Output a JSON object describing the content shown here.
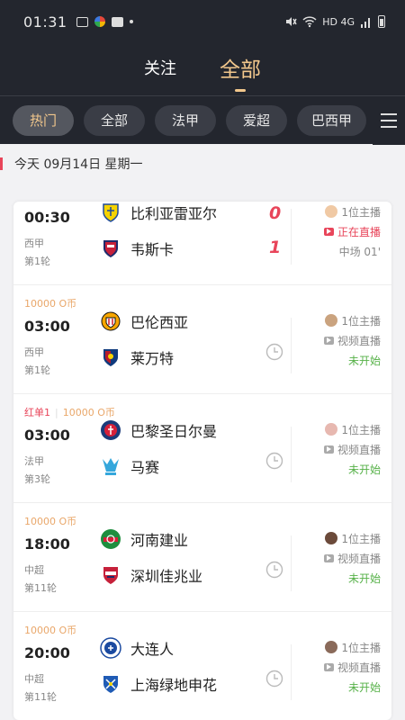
{
  "status_bar": {
    "time": "01:31",
    "network": "HD 4G"
  },
  "main_tabs": [
    {
      "label": "关注"
    },
    {
      "label": "全部"
    }
  ],
  "league_tabs": [
    {
      "label": "热门"
    },
    {
      "label": "全部"
    },
    {
      "label": "法甲"
    },
    {
      "label": "爱超"
    },
    {
      "label": "巴西甲"
    }
  ],
  "date_header": "今天 09月14日 星期一",
  "matches": [
    {
      "tags": "",
      "time": "00:30",
      "league": "西甲",
      "round": "第1轮",
      "home": "比利亚雷亚尔",
      "away": "韦斯卡",
      "home_score": "0",
      "away_score": "1",
      "anchors": "1位主播",
      "broadcast": "正在直播",
      "status": "中场 01'"
    },
    {
      "tags": "10000 O币",
      "time": "03:00",
      "league": "西甲",
      "round": "第1轮",
      "home": "巴伦西亚",
      "away": "莱万特",
      "anchors": "1位主播",
      "broadcast": "视频直播",
      "status": "未开始"
    },
    {
      "tag_red": "红单1",
      "tags": "10000 O币",
      "time": "03:00",
      "league": "法甲",
      "round": "第3轮",
      "home": "巴黎圣日尔曼",
      "away": "马赛",
      "anchors": "1位主播",
      "broadcast": "视频直播",
      "status": "未开始"
    },
    {
      "tags": "10000 O币",
      "time": "18:00",
      "league": "中超",
      "round": "第11轮",
      "home": "河南建业",
      "away": "深圳佳兆业",
      "anchors": "1位主播",
      "broadcast": "视频直播",
      "status": "未开始"
    },
    {
      "tags": "10000 O币",
      "time": "20:00",
      "league": "中超",
      "round": "第11轮",
      "home": "大连人",
      "away": "上海绿地申花",
      "anchors": "1位主播",
      "broadcast": "视频直播",
      "status": "未开始"
    }
  ],
  "colors": {
    "header_bg": "#23262e",
    "accent": "#f2c78c",
    "live_red": "#e8455a",
    "not_started_green": "#56b148",
    "coin_orange": "#e9a76a"
  }
}
